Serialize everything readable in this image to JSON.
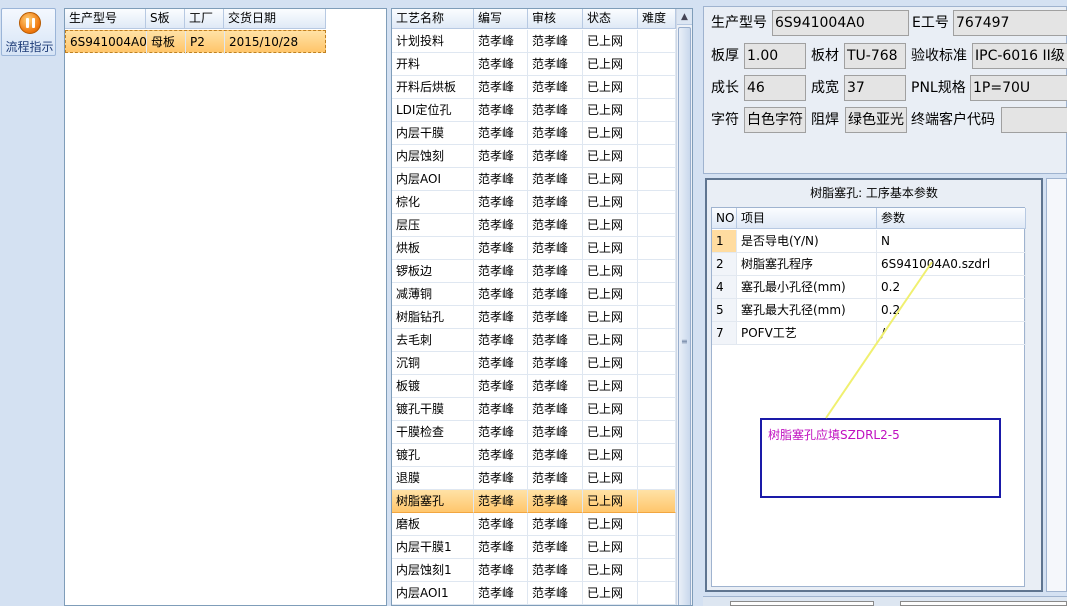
{
  "nav": {
    "flow_label": "流程指示"
  },
  "orders": {
    "headers": [
      "生产型号",
      "S板",
      "工厂",
      "交货日期"
    ],
    "rows": [
      [
        "6S941004A0",
        "母板",
        "P2",
        "2015/10/28"
      ]
    ]
  },
  "processes": {
    "headers": [
      "工艺名称",
      "编写",
      "审核",
      "状态",
      "难度"
    ],
    "rows": [
      [
        "计划投料",
        "范孝峰",
        "范孝峰",
        "已上网"
      ],
      [
        "开料",
        "范孝峰",
        "范孝峰",
        "已上网"
      ],
      [
        "开料后烘板",
        "范孝峰",
        "范孝峰",
        "已上网"
      ],
      [
        "LDI定位孔",
        "范孝峰",
        "范孝峰",
        "已上网"
      ],
      [
        "内层干膜",
        "范孝峰",
        "范孝峰",
        "已上网"
      ],
      [
        "内层蚀刻",
        "范孝峰",
        "范孝峰",
        "已上网"
      ],
      [
        "内层AOI",
        "范孝峰",
        "范孝峰",
        "已上网"
      ],
      [
        "棕化",
        "范孝峰",
        "范孝峰",
        "已上网"
      ],
      [
        "层压",
        "范孝峰",
        "范孝峰",
        "已上网"
      ],
      [
        "烘板",
        "范孝峰",
        "范孝峰",
        "已上网"
      ],
      [
        "锣板边",
        "范孝峰",
        "范孝峰",
        "已上网"
      ],
      [
        "减薄铜",
        "范孝峰",
        "范孝峰",
        "已上网"
      ],
      [
        "树脂钻孔",
        "范孝峰",
        "范孝峰",
        "已上网"
      ],
      [
        "去毛刺",
        "范孝峰",
        "范孝峰",
        "已上网"
      ],
      [
        "沉铜",
        "范孝峰",
        "范孝峰",
        "已上网"
      ],
      [
        "板镀",
        "范孝峰",
        "范孝峰",
        "已上网"
      ],
      [
        "镀孔干膜",
        "范孝峰",
        "范孝峰",
        "已上网"
      ],
      [
        "干膜检查",
        "范孝峰",
        "范孝峰",
        "已上网"
      ],
      [
        "镀孔",
        "范孝峰",
        "范孝峰",
        "已上网"
      ],
      [
        "退膜",
        "范孝峰",
        "范孝峰",
        "已上网"
      ],
      [
        "树脂塞孔",
        "范孝峰",
        "范孝峰",
        "已上网"
      ],
      [
        "磨板",
        "范孝峰",
        "范孝峰",
        "已上网"
      ],
      [
        "内层干膜1",
        "范孝峰",
        "范孝峰",
        "已上网"
      ],
      [
        "内层蚀刻1",
        "范孝峰",
        "范孝峰",
        "已上网"
      ],
      [
        "内层AOI1",
        "范孝峰",
        "范孝峰",
        "已上网"
      ]
    ],
    "selected_index": 20
  },
  "info": {
    "model_label": "生产型号",
    "model_value": "6S941004A0",
    "e_label": "E工号",
    "e_value": "767497",
    "thickness_label": "板厚",
    "thickness_value": "1.00",
    "material_label": "板材",
    "material_value": "TU-768",
    "standard_label": "验收标准",
    "standard_value": "IPC-6016 II级",
    "length_label": "成长",
    "length_value": "46",
    "width_label": "成宽",
    "width_value": "37",
    "pnl_label": "PNL规格",
    "pnl_value": "1P=70U",
    "char_label": "字符",
    "char_value": "白色字符",
    "mask_label": "阻焊",
    "mask_value": "绿色亚光",
    "customer_label": "终端客户代码",
    "customer_value": ""
  },
  "params": {
    "title": "树脂塞孔: 工序基本参数",
    "headers": [
      "NO",
      "项目",
      "参数"
    ],
    "rows": [
      [
        "1",
        "是否导电(Y/N)",
        "N"
      ],
      [
        "2",
        "树脂塞孔程序",
        "6S941004A0.szdrl"
      ],
      [
        "4",
        "塞孔最小孔径(mm)",
        "0.2"
      ],
      [
        "5",
        "塞孔最大孔径(mm)",
        "0.2"
      ],
      [
        "7",
        "POFV工艺",
        "/"
      ]
    ]
  },
  "note": {
    "text": "树脂塞孔应填SZDRL2-5",
    "color": "#c010c0",
    "callout_color": "#f0f070"
  },
  "colors": {
    "selected_row": "#ffc56a",
    "note_border": "#1a1aa8"
  }
}
